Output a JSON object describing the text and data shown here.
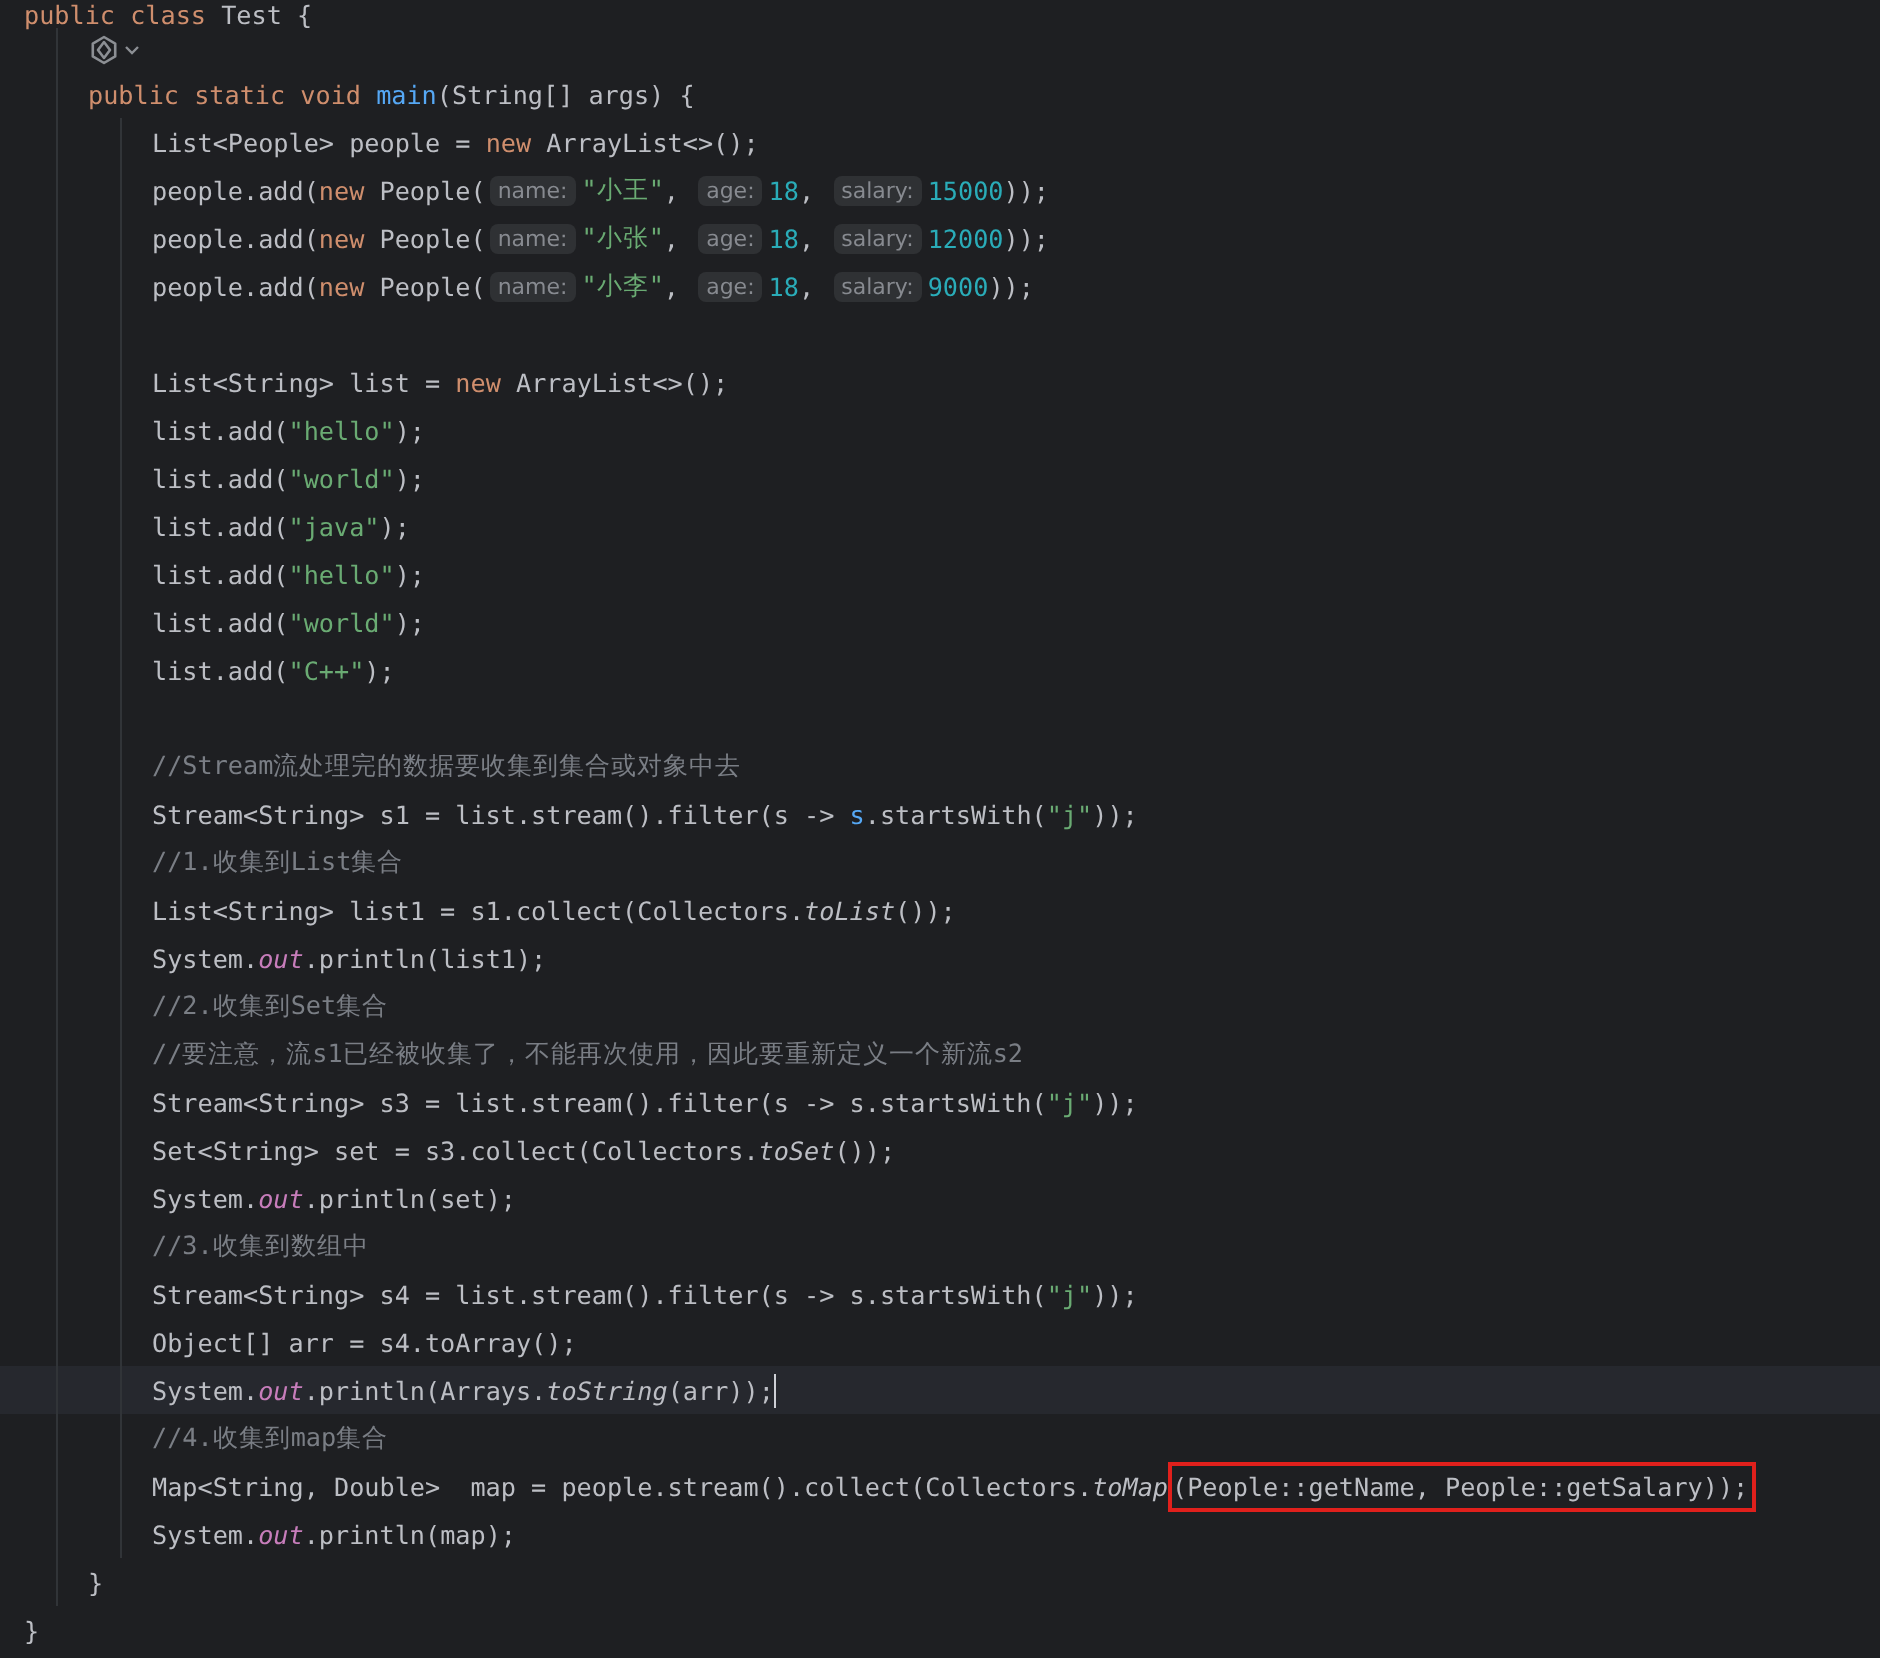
{
  "lines": [
    {
      "kind": "code",
      "current": false,
      "tokens": [
        {
          "kind": "kw",
          "text": "public class"
        },
        {
          "kind": "p",
          "text": " Test {"
        }
      ],
      "children": [
        {
          "kind": "icon",
          "current": false
        },
        {
          "kind": "code",
          "current": false,
          "tokens": [
            {
              "kind": "kw",
              "text": "public static void "
            },
            {
              "kind": "decl",
              "text": "main"
            },
            {
              "kind": "p",
              "text": "(String[] args) {"
            }
          ],
          "children": [
            {
              "kind": "code",
              "current": false,
              "tokens": [
                {
                  "kind": "p",
                  "text": "List<People> people = "
                },
                {
                  "kind": "kw",
                  "text": "new"
                },
                {
                  "kind": "p",
                  "text": " ArrayList<>();"
                }
              ]
            },
            {
              "kind": "code",
              "current": false,
              "tokens": [
                {
                  "kind": "p",
                  "text": "people.add("
                },
                {
                  "kind": "kw",
                  "text": "new"
                },
                {
                  "kind": "p",
                  "text": " People("
                },
                {
                  "kind": "hint",
                  "text": "name:"
                },
                {
                  "kind": "str",
                  "text": "\"小王\""
                },
                {
                  "kind": "p",
                  "text": ", "
                },
                {
                  "kind": "hint",
                  "text": "age:"
                },
                {
                  "kind": "num",
                  "text": "18"
                },
                {
                  "kind": "p",
                  "text": ", "
                },
                {
                  "kind": "hint",
                  "text": "salary:"
                },
                {
                  "kind": "num",
                  "text": "15000"
                },
                {
                  "kind": "p",
                  "text": "));"
                }
              ]
            },
            {
              "kind": "code",
              "current": false,
              "tokens": [
                {
                  "kind": "p",
                  "text": "people.add("
                },
                {
                  "kind": "kw",
                  "text": "new"
                },
                {
                  "kind": "p",
                  "text": " People("
                },
                {
                  "kind": "hint",
                  "text": "name:"
                },
                {
                  "kind": "str",
                  "text": "\"小张\""
                },
                {
                  "kind": "p",
                  "text": ", "
                },
                {
                  "kind": "hint",
                  "text": "age:"
                },
                {
                  "kind": "num",
                  "text": "18"
                },
                {
                  "kind": "p",
                  "text": ", "
                },
                {
                  "kind": "hint",
                  "text": "salary:"
                },
                {
                  "kind": "num",
                  "text": "12000"
                },
                {
                  "kind": "p",
                  "text": "));"
                }
              ]
            },
            {
              "kind": "code",
              "current": false,
              "tokens": [
                {
                  "kind": "p",
                  "text": "people.add("
                },
                {
                  "kind": "kw",
                  "text": "new"
                },
                {
                  "kind": "p",
                  "text": " People("
                },
                {
                  "kind": "hint",
                  "text": "name:"
                },
                {
                  "kind": "str",
                  "text": "\"小李\""
                },
                {
                  "kind": "p",
                  "text": ", "
                },
                {
                  "kind": "hint",
                  "text": "age:"
                },
                {
                  "kind": "num",
                  "text": "18"
                },
                {
                  "kind": "p",
                  "text": ", "
                },
                {
                  "kind": "hint",
                  "text": "salary:"
                },
                {
                  "kind": "num",
                  "text": "9000"
                },
                {
                  "kind": "p",
                  "text": "));"
                }
              ]
            },
            {
              "kind": "blank",
              "current": false
            },
            {
              "kind": "code",
              "current": false,
              "tokens": [
                {
                  "kind": "p",
                  "text": "List<String> list = "
                },
                {
                  "kind": "kw",
                  "text": "new"
                },
                {
                  "kind": "p",
                  "text": " ArrayList<>();"
                }
              ]
            },
            {
              "kind": "code",
              "current": false,
              "tokens": [
                {
                  "kind": "p",
                  "text": "list.add("
                },
                {
                  "kind": "str",
                  "text": "\"hello\""
                },
                {
                  "kind": "p",
                  "text": ");"
                }
              ]
            },
            {
              "kind": "code",
              "current": false,
              "tokens": [
                {
                  "kind": "p",
                  "text": "list.add("
                },
                {
                  "kind": "str",
                  "text": "\"world\""
                },
                {
                  "kind": "p",
                  "text": ");"
                }
              ]
            },
            {
              "kind": "code",
              "current": false,
              "tokens": [
                {
                  "kind": "p",
                  "text": "list.add("
                },
                {
                  "kind": "str",
                  "text": "\"java\""
                },
                {
                  "kind": "p",
                  "text": ");"
                }
              ]
            },
            {
              "kind": "code",
              "current": false,
              "tokens": [
                {
                  "kind": "p",
                  "text": "list.add("
                },
                {
                  "kind": "str",
                  "text": "\"hello\""
                },
                {
                  "kind": "p",
                  "text": ");"
                }
              ]
            },
            {
              "kind": "code",
              "current": false,
              "tokens": [
                {
                  "kind": "p",
                  "text": "list.add("
                },
                {
                  "kind": "str",
                  "text": "\"world\""
                },
                {
                  "kind": "p",
                  "text": ");"
                }
              ]
            },
            {
              "kind": "code",
              "current": false,
              "tokens": [
                {
                  "kind": "p",
                  "text": "list.add("
                },
                {
                  "kind": "str",
                  "text": "\"C++\""
                },
                {
                  "kind": "p",
                  "text": ");"
                }
              ]
            },
            {
              "kind": "blank",
              "current": false
            },
            {
              "kind": "code",
              "current": false,
              "tokens": [
                {
                  "kind": "comment",
                  "text": "//Stream流处理完的数据要收集到集合或对象中去"
                }
              ]
            },
            {
              "kind": "code",
              "current": false,
              "tokens": [
                {
                  "kind": "p",
                  "text": "Stream<String> s1 = list.stream().filter(s -> "
                },
                {
                  "kind": "ref",
                  "text": "s"
                },
                {
                  "kind": "p",
                  "text": ".startsWith("
                },
                {
                  "kind": "str",
                  "text": "\"j\""
                },
                {
                  "kind": "p",
                  "text": "));"
                }
              ]
            },
            {
              "kind": "code",
              "current": false,
              "tokens": [
                {
                  "kind": "comment",
                  "text": "//1.收集到List集合"
                }
              ]
            },
            {
              "kind": "code",
              "current": false,
              "tokens": [
                {
                  "kind": "p",
                  "text": "List<String> list1 = s1.collect(Collectors."
                },
                {
                  "kind": "smethod",
                  "text": "toList"
                },
                {
                  "kind": "p",
                  "text": "());"
                }
              ]
            },
            {
              "kind": "code",
              "current": false,
              "tokens": [
                {
                  "kind": "p",
                  "text": "System."
                },
                {
                  "kind": "field",
                  "text": "out"
                },
                {
                  "kind": "p",
                  "text": ".println(list1);"
                }
              ]
            },
            {
              "kind": "code",
              "current": false,
              "tokens": [
                {
                  "kind": "comment",
                  "text": "//2.收集到Set集合"
                }
              ]
            },
            {
              "kind": "code",
              "current": false,
              "tokens": [
                {
                  "kind": "comment",
                  "text": "//要注意，流s1已经被收集了，不能再次使用，因此要重新定义一个新流s2"
                }
              ]
            },
            {
              "kind": "code",
              "current": false,
              "tokens": [
                {
                  "kind": "p",
                  "text": "Stream<String> s3 = list.stream().filter(s -> s.startsWith("
                },
                {
                  "kind": "str",
                  "text": "\"j\""
                },
                {
                  "kind": "p",
                  "text": "));"
                }
              ]
            },
            {
              "kind": "code",
              "current": false,
              "tokens": [
                {
                  "kind": "p",
                  "text": "Set<String> set = s3.collect(Collectors."
                },
                {
                  "kind": "smethod",
                  "text": "toSet"
                },
                {
                  "kind": "p",
                  "text": "());"
                }
              ]
            },
            {
              "kind": "code",
              "current": false,
              "tokens": [
                {
                  "kind": "p",
                  "text": "System."
                },
                {
                  "kind": "field",
                  "text": "out"
                },
                {
                  "kind": "p",
                  "text": ".println(set);"
                }
              ]
            },
            {
              "kind": "code",
              "current": false,
              "tokens": [
                {
                  "kind": "comment",
                  "text": "//3.收集到数组中"
                }
              ]
            },
            {
              "kind": "code",
              "current": false,
              "tokens": [
                {
                  "kind": "p",
                  "text": "Stream<String> s4 = list.stream().filter(s -> s.startsWith("
                },
                {
                  "kind": "str",
                  "text": "\"j\""
                },
                {
                  "kind": "p",
                  "text": "));"
                }
              ]
            },
            {
              "kind": "code",
              "current": false,
              "tokens": [
                {
                  "kind": "p",
                  "text": "Object[] arr = s4.toArray();"
                }
              ]
            },
            {
              "kind": "code",
              "current": true,
              "tokens": [
                {
                  "kind": "p",
                  "text": "System."
                },
                {
                  "kind": "field",
                  "text": "out"
                },
                {
                  "kind": "p",
                  "text": ".println(Arrays."
                },
                {
                  "kind": "smethod",
                  "text": "toString"
                },
                {
                  "kind": "p",
                  "text": "(arr));"
                }
              ]
            },
            {
              "kind": "code",
              "current": false,
              "tokens": [
                {
                  "kind": "comment",
                  "text": "//4.收集到map集合"
                }
              ]
            },
            {
              "kind": "code",
              "current": false,
              "tokens": [
                {
                  "kind": "p",
                  "text": "Map<String, Double>  map = people.stream().collect(Collectors."
                },
                {
                  "kind": "smethod",
                  "text": "toMap"
                },
                {
                  "kind": "box",
                  "tokens": [
                    {
                      "kind": "p",
                      "text": "(People::getName, People::getSalary));"
                    }
                  ]
                }
              ]
            },
            {
              "kind": "code",
              "current": false,
              "tokens": [
                {
                  "kind": "p",
                  "text": "System."
                },
                {
                  "kind": "field",
                  "text": "out"
                },
                {
                  "kind": "p",
                  "text": ".println(map);"
                }
              ]
            }
          ]
        },
        {
          "kind": "code",
          "current": false,
          "tokens": [
            {
              "kind": "p",
              "text": "}"
            }
          ]
        }
      ]
    },
    {
      "kind": "code",
      "current": false,
      "tokens": [
        {
          "kind": "p",
          "text": "}"
        }
      ]
    }
  ]
}
